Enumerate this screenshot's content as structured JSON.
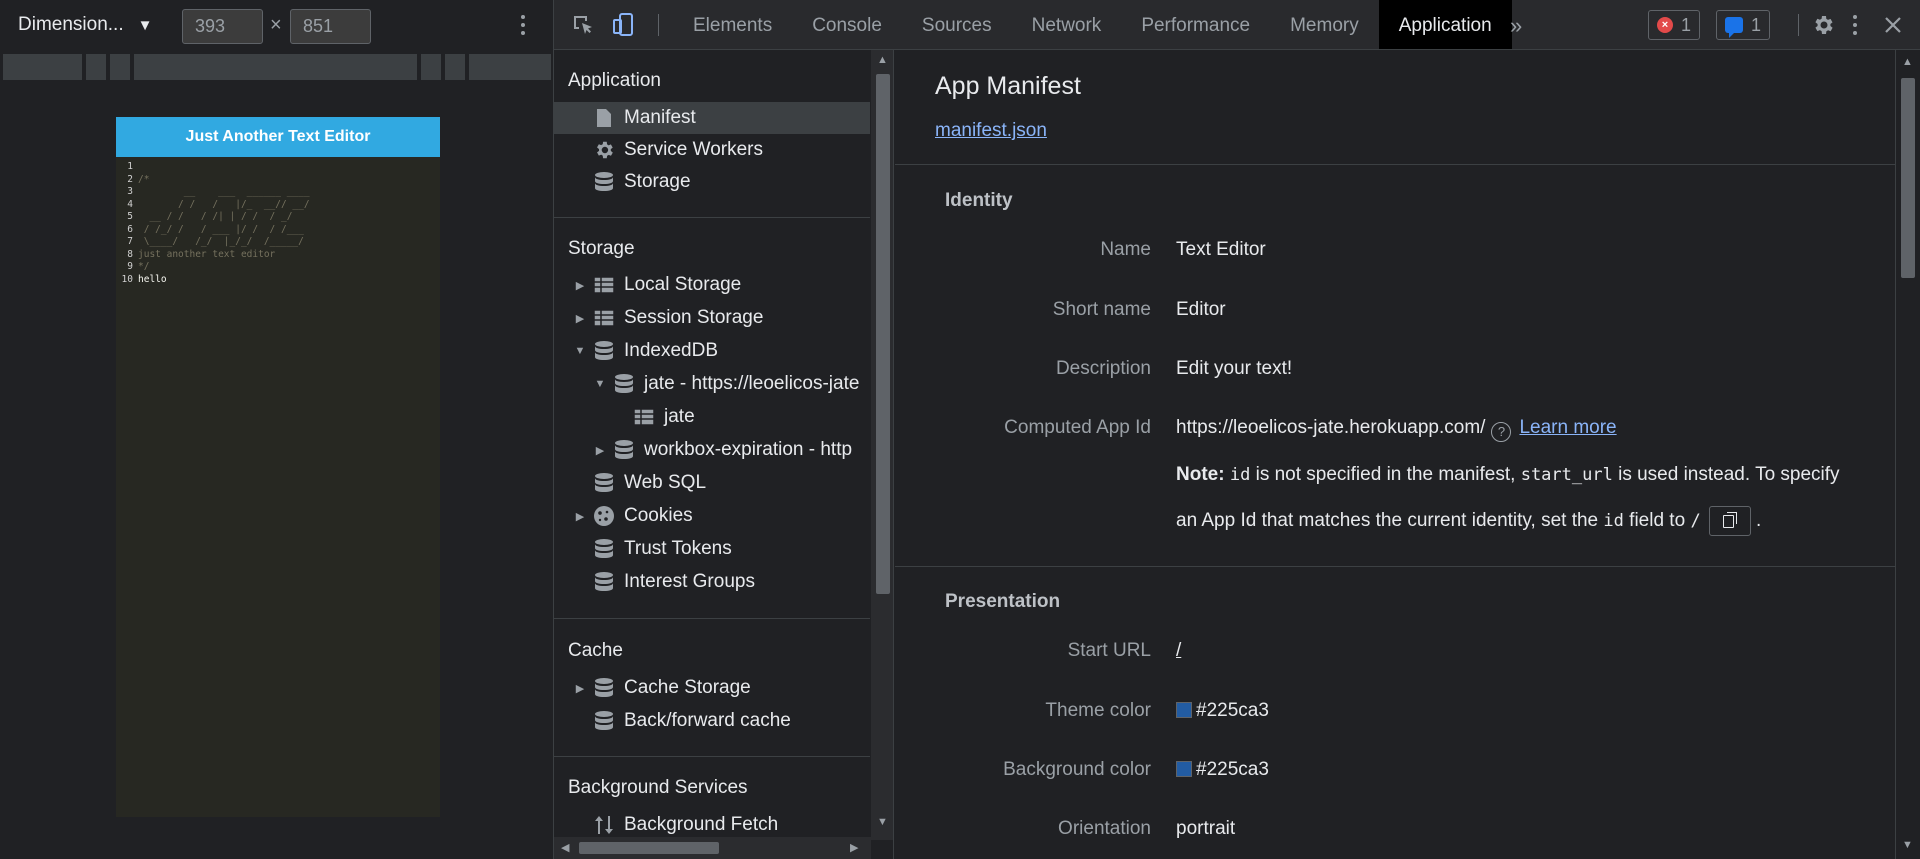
{
  "device_toolbar": {
    "dimensions_label": "Dimension...",
    "width": "393",
    "height": "851",
    "times": "×"
  },
  "device_app": {
    "header": "Just Another Text Editor",
    "lines": [
      {
        "n": "1",
        "t": ""
      },
      {
        "n": "2",
        "t": "/*"
      },
      {
        "n": "3",
        "t": "        __    ___  ______ ____"
      },
      {
        "n": "4",
        "t": "       / /   /   |/_  __// __/"
      },
      {
        "n": "5",
        "t": "  __ / /   / /| | / /  / _/"
      },
      {
        "n": "6",
        "t": " / /_/ /   / ___ |/ /  / /___"
      },
      {
        "n": "7",
        "t": " \\____/   /_/  |_/_/  /_____/"
      },
      {
        "n": "8",
        "t": "just another text editor"
      },
      {
        "n": "9",
        "t": "*/"
      },
      {
        "n": "10",
        "t": "hello"
      }
    ]
  },
  "toolbar": {
    "tabs": [
      "Elements",
      "Console",
      "Sources",
      "Network",
      "Performance",
      "Memory",
      "Application"
    ],
    "active_tab": "Application",
    "more": "»",
    "error_count": "1",
    "message_count": "1"
  },
  "sidebar": {
    "application_title": "Application",
    "application_items": [
      "Manifest",
      "Service Workers",
      "Storage"
    ],
    "storage_title": "Storage",
    "storage_items": [
      "Local Storage",
      "Session Storage",
      "IndexedDB",
      "jate - https://leoelicos-jate",
      "jate",
      "workbox-expiration - http",
      "Web SQL",
      "Cookies",
      "Trust Tokens",
      "Interest Groups"
    ],
    "cache_title": "Cache",
    "cache_items": [
      "Cache Storage",
      "Back/forward cache"
    ],
    "background_title": "Background Services",
    "background_items": [
      "Background Fetch"
    ]
  },
  "manifest": {
    "title": "App Manifest",
    "link": "manifest.json",
    "identity": {
      "heading": "Identity",
      "name_label": "Name",
      "name_value": "Text Editor",
      "short_name_label": "Short name",
      "short_name_value": "Editor",
      "description_label": "Description",
      "description_value": "Edit your text!",
      "app_id_label": "Computed App Id",
      "app_id_value": "https://leoelicos-jate.herokuapp.com/",
      "learn_more": "Learn more",
      "note_bold": "Note:",
      "note_code1": "id",
      "note_text1": "is not specified in the manifest,",
      "note_code2": "start_url",
      "note_text2": "is used instead. To specify",
      "note_text3": "an App Id that matches the current identity, set the",
      "note_code3": "id",
      "note_text4": "field to",
      "note_code4": "/",
      "note_end": "."
    },
    "presentation": {
      "heading": "Presentation",
      "start_url_label": "Start URL",
      "start_url_value": "/",
      "theme_color_label": "Theme color",
      "theme_color_value": "#225ca3",
      "background_color_label": "Background color",
      "background_color_value": "#225ca3",
      "orientation_label": "Orientation",
      "orientation_value": "portrait"
    }
  },
  "colors": {
    "accent": "#31a9e1",
    "link": "#8ab4f8",
    "swatch": "#225ca3"
  }
}
